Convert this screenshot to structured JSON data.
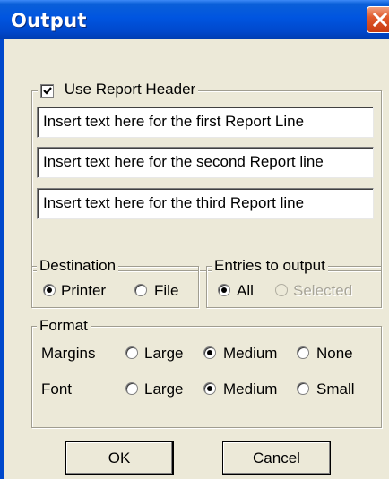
{
  "window": {
    "title": "Output"
  },
  "report_header": {
    "checkbox_label": "Use Report Header",
    "checked": true,
    "lines": [
      "Insert text here for the first Report Line",
      "Insert text here for the second Report line",
      "Insert text here for the third Report line"
    ]
  },
  "destination": {
    "legend": "Destination",
    "options": [
      "Printer",
      "File"
    ],
    "selected": "Printer"
  },
  "entries": {
    "legend": "Entries to output",
    "options": [
      "All",
      "Selected"
    ],
    "selected": "All"
  },
  "format": {
    "legend": "Format",
    "margins_label": "Margins",
    "font_label": "Font",
    "margins_options": [
      "Large",
      "Medium",
      "None"
    ],
    "margins_selected": "Medium",
    "font_options": [
      "Large",
      "Medium",
      "Small"
    ],
    "font_selected": "Medium"
  },
  "buttons": {
    "ok": "OK",
    "cancel": "Cancel"
  }
}
